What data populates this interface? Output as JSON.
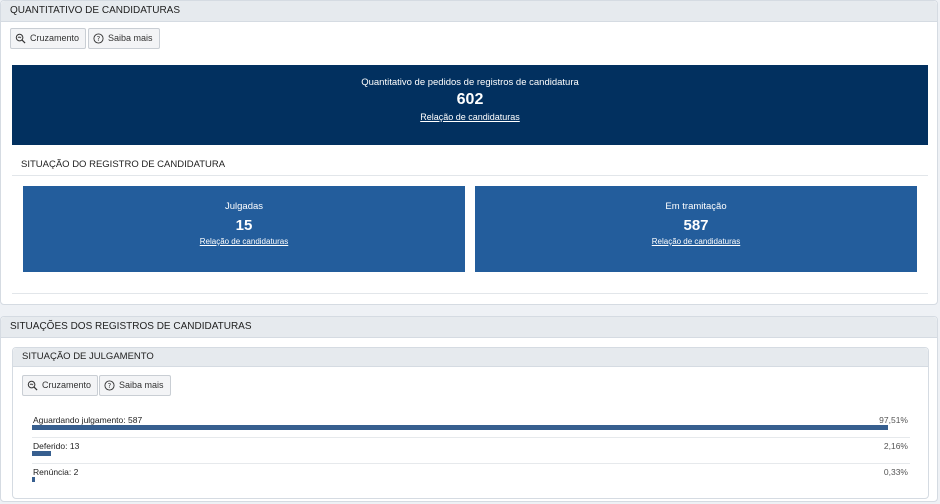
{
  "panel1": {
    "title": "QUANTITATIVO DE CANDIDATURAS",
    "buttons": {
      "cruzamento": "Cruzamento",
      "saiba_mais": "Saiba mais"
    },
    "main_card": {
      "title": "Quantitativo de pedidos de registros de candidatura",
      "value": "602",
      "link": "Relação de candidaturas",
      "color": "#02305f"
    },
    "section_title": "SITUAÇÃO DO REGISTRO DE CANDIDATURA",
    "cards": [
      {
        "title": "Julgadas",
        "value": "15",
        "link": "Relação de candidaturas"
      },
      {
        "title": "Em tramitação",
        "value": "587",
        "link": "Relação de candidaturas"
      }
    ],
    "card_color": "#235d9c"
  },
  "panel2": {
    "title": "SITUAÇÕES DOS REGISTROS DE CANDIDATURAS",
    "sub_title": "SITUAÇÃO DE JULGAMENTO",
    "buttons": {
      "cruzamento": "Cruzamento",
      "saiba_mais": "Saiba mais"
    },
    "bars": [
      {
        "label": "Aguardando julgamento: 587",
        "percent_label": "97,51%",
        "fraction": 0.9751
      },
      {
        "label": "Deferido: 13",
        "percent_label": "2,16%",
        "fraction": 0.0216
      },
      {
        "label": "Renúncia: 2",
        "percent_label": "0,33%",
        "fraction": 0.0033
      }
    ],
    "bar_color": "#375f8f"
  }
}
